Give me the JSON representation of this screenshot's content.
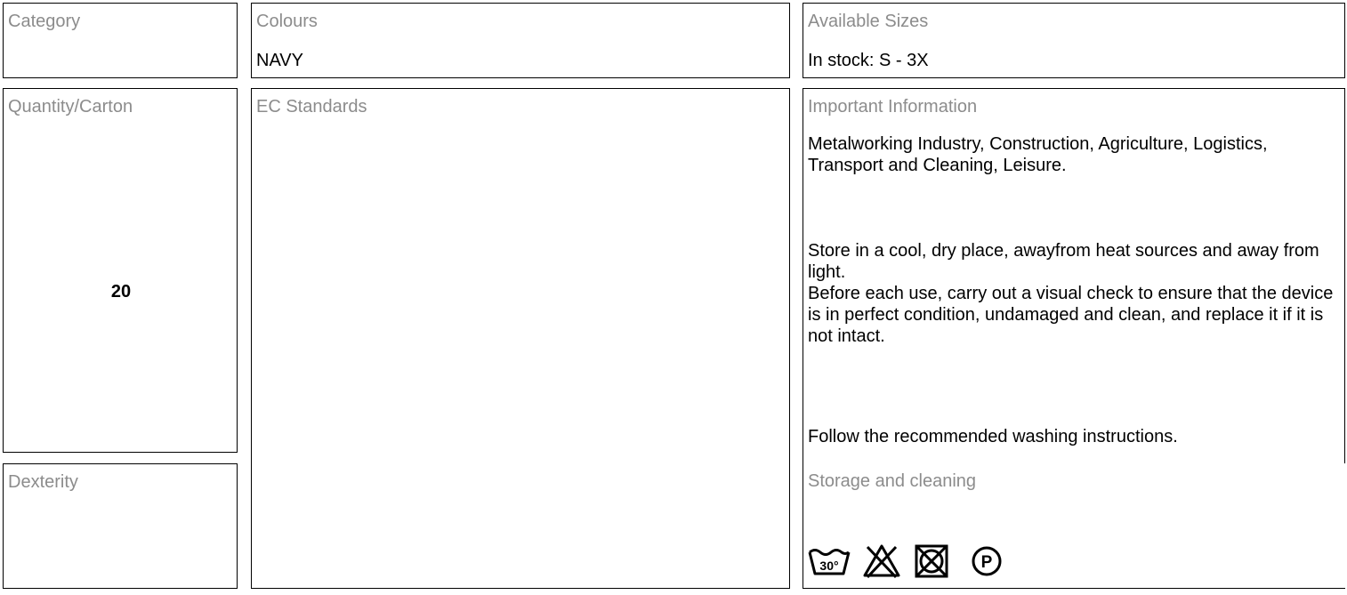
{
  "category": {
    "label": "Category",
    "value": ""
  },
  "colours": {
    "label": "Colours",
    "value": "NAVY"
  },
  "available_sizes": {
    "label": "Available Sizes",
    "value": "In stock: S - 3X"
  },
  "quantity_carton": {
    "label": "Quantity/Carton",
    "value": "20"
  },
  "ec_standards": {
    "label": "EC Standards"
  },
  "important_information": {
    "label": "Important Information",
    "paragraph1": "Metalworking Industry, Construction, Agriculture, Logistics, Transport and Cleaning, Leisure.",
    "paragraph2": "Store in a cool, dry place, awayfrom heat sources and away from light.",
    "paragraph3": "Before each use, carry out a visual check to ensure that the device is in perfect condition, undamaged and clean, and replace it if it is not intact.",
    "paragraph4": "Follow the recommended washing instructions."
  },
  "dexterity": {
    "label": "Dexterity",
    "value": ""
  },
  "storage_cleaning": {
    "label": "Storage and cleaning",
    "icons": [
      "wash-30-icon",
      "do-not-bleach-icon",
      "do-not-tumble-dry-icon",
      "professional-dry-clean-p-icon"
    ],
    "wash_temperature": "30°",
    "dry_clean_letter": "P"
  }
}
